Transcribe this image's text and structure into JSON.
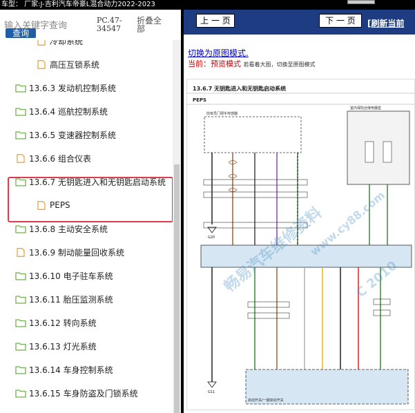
{
  "header": {
    "vehicle_line": "车型： 厂家:J-吉利汽车帝豪L混合动力2022-2023"
  },
  "search": {
    "placeholder": "输入关键字查询",
    "button_label": "查询",
    "code": "PC.47-34547",
    "collapse_all": "折叠全部"
  },
  "tree": {
    "items": [
      {
        "label": "冷却系统",
        "type": "file",
        "indent": 2
      },
      {
        "label": "高压互锁系统",
        "type": "file",
        "indent": 2
      },
      {
        "label": "13.6.3 发动机控制系统",
        "type": "folder",
        "indent": 1
      },
      {
        "label": "13.6.4 巡航控制系统",
        "type": "folder",
        "indent": 1
      },
      {
        "label": "13.6.5 变速器控制系统",
        "type": "folder",
        "indent": 1
      },
      {
        "label": "13.6.6 组合仪表",
        "type": "file",
        "indent": 1
      },
      {
        "label": "13.6.7 无钥匙进入和无钥匙启动系统",
        "type": "folder",
        "indent": 1
      },
      {
        "label": "PEPS",
        "type": "file",
        "indent": 2
      },
      {
        "label": "13.6.8 主动安全系统",
        "type": "folder",
        "indent": 1
      },
      {
        "label": "13.6.9 制动能量回收系统",
        "type": "file",
        "indent": 1
      },
      {
        "label": "13.6.10 电子驻车系统",
        "type": "folder",
        "indent": 1
      },
      {
        "label": "13.6.11 胎压监测系统",
        "type": "folder",
        "indent": 1
      },
      {
        "label": "13.6.12 转向系统",
        "type": "folder",
        "indent": 1
      },
      {
        "label": "13.6.13 灯光系统",
        "type": "folder",
        "indent": 1
      },
      {
        "label": "13.6.14 车身控制系统",
        "type": "folder",
        "indent": 1
      },
      {
        "label": "13.6.15 车身防盗及门锁系统",
        "type": "folder",
        "indent": 1
      }
    ]
  },
  "viewer": {
    "prev_label": "上 一 页",
    "next_label": "下 一 页",
    "refresh_label": "[刷新当前",
    "switch_label": "切换为原图模式.",
    "current_prefix": "当前：",
    "current_mode": "预览模式",
    "current_hint": "若看着大图，切换至原图模式",
    "diagram_title": "13.6.7 无钥匙进入和无钥匙启动系统",
    "diagram_subtitle": "PEPS",
    "label_front_antenna": "前亲员门把手传感器",
    "label_fuse_box": "室内保险丝继电器盒",
    "label_start_switch": "启动开关/一键启动开关",
    "ground_1": "G20",
    "ground_2": "G11",
    "watermarks": [
      "畅易汽车维修资料",
      "www.cy88.com",
      "C 2010"
    ]
  },
  "colors": {
    "nav_blue": "#1e3c82",
    "select_red": "#e23a4c",
    "folder_green": "#6fb14a",
    "file_orange": "#e8a640",
    "button_blue": "#1f5fa6"
  }
}
